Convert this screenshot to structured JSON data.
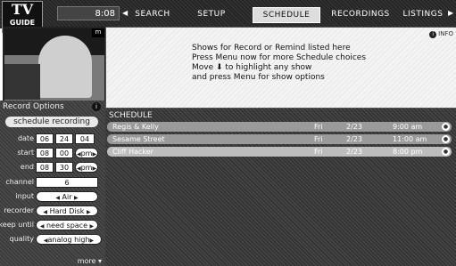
{
  "logo": {
    "tv": "TV",
    "guide": "GUIDE"
  },
  "topbar": {
    "clock": "8:08",
    "tabs": [
      {
        "label": "SEARCH"
      },
      {
        "label": "SETUP"
      },
      {
        "label": "SCHEDULE"
      },
      {
        "label": "RECORDINGS"
      },
      {
        "label": "LISTINGS"
      }
    ],
    "active_tab": "SCHEDULE"
  },
  "preview": {
    "corner": "m"
  },
  "info": {
    "badge": "INFO",
    "lines": [
      "Shows for Record or Remind listed here",
      "Press Menu now for more Schedule choices",
      "Move ⬇ to highlight any show",
      "and press Menu for show options"
    ]
  },
  "record_options": {
    "title": "Record Options",
    "info_icon": "i",
    "schedule_label": "schedule recording",
    "date_label": "date",
    "date": {
      "month": "06",
      "day": "24",
      "year": "04"
    },
    "start_label": "start",
    "start": {
      "hour": "08",
      "min": "00",
      "ampm": "pm"
    },
    "end_label": "end",
    "end": {
      "hour": "08",
      "min": "30",
      "ampm": "pm"
    },
    "channel_label": "channel",
    "channel": "6",
    "input_label": "input",
    "input": "Air",
    "recorder_label": "recorder",
    "recorder": "Hard Disk",
    "keep_label": "keep until",
    "keep": "need space",
    "quality_label": "quality",
    "quality": "analog high",
    "more": "more ▾"
  },
  "schedule": {
    "title": "SCHEDULE",
    "rows": [
      {
        "title": "Regis & Kelly",
        "day": "Fri",
        "date": "2/23",
        "time": "9:00 am"
      },
      {
        "title": "Sesame Street",
        "day": "Fri",
        "date": "2/23",
        "time": "11:00 am"
      },
      {
        "title": "Cliff Hacker",
        "day": "Fri",
        "date": "2/23",
        "time": "8:00 pm"
      }
    ]
  }
}
